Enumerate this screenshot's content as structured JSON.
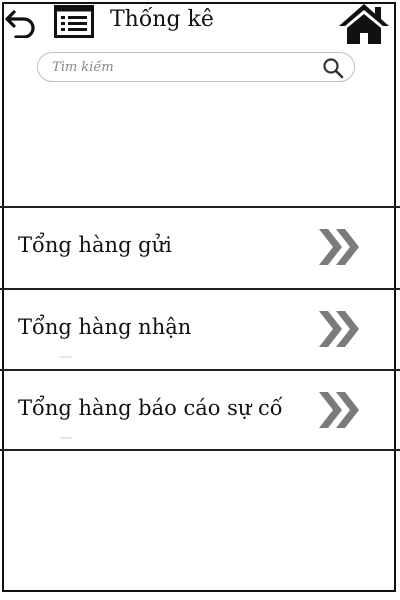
{
  "header": {
    "title": "Thống kê"
  },
  "search": {
    "placeholder": "Tìm kiếm"
  },
  "menu": {
    "items": [
      {
        "label": "Tổng hàng gửi"
      },
      {
        "label": "Tổng hàng nhận"
      },
      {
        "label": "Tổng hàng báo cáo sự cố"
      }
    ]
  },
  "icons": {
    "back": "back-arrow-icon",
    "menu": "list-icon",
    "home": "home-icon",
    "search": "search-icon",
    "row_arrow": "double-chevron-right-icon"
  },
  "colors": {
    "chevron": "#7b7b7b",
    "border": "#111111"
  }
}
